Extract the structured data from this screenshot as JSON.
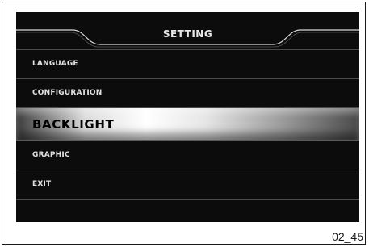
{
  "screen": {
    "title": "SETTING",
    "menu": [
      {
        "label": "LANGUAGE",
        "selected": false
      },
      {
        "label": "CONFIGURATION",
        "selected": false
      },
      {
        "label": "BACKLIGHT",
        "selected": true
      },
      {
        "label": "GRAPHIC",
        "selected": false
      },
      {
        "label": "EXIT",
        "selected": false
      }
    ]
  },
  "figure": {
    "ref_code": "02_45"
  },
  "colors": {
    "screen_background": "#0c0c0c",
    "text": "#e2e2e2",
    "selected_text": "#000000",
    "divider": "#4a4a4a"
  }
}
